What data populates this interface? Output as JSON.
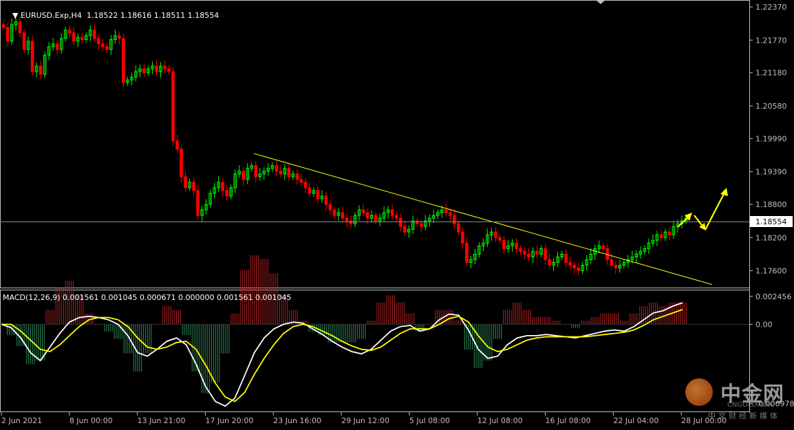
{
  "header": {
    "symbol": "EURUSD.Exp,H4",
    "ohlc": "1.18522 1.18616 1.18511 1.18554"
  },
  "macd_header": {
    "label": "MACD(12,26,9) 0.001561 0.001045 0.000671 0.000000 0.001561 0.001045"
  },
  "current_price": "1.18554",
  "colors": {
    "background": "#000000",
    "bull": "#00ff00",
    "bear": "#ff0000",
    "trendline": "#ffff00",
    "macd_line": "#ffffff",
    "signal_line": "#ffff00",
    "hist_pos": "#b22222",
    "hist_neg": "#2e8b57",
    "axis": "#c0c0c0"
  },
  "watermark": {
    "brand_cn": "中金网",
    "brand_en": "CNGOLD.ORG",
    "tagline": "中文财经新媒体"
  },
  "chart_data": [
    {
      "type": "candlestick",
      "title": "",
      "price_axis_labels": [
        "1.22370",
        "1.21770",
        "1.21180",
        "1.20580",
        "1.19990",
        "1.19390",
        "1.18800",
        "1.18200",
        "1.17600"
      ],
      "time_axis_labels": [
        "2 Jun 2021",
        "8 Jun 00:00",
        "13 Jun 21:00",
        "17 Jun 20:00",
        "23 Jun 16:00",
        "29 Jun 12:00",
        "5 Jul 08:00",
        "12 Jul 08:00",
        "16 Jul 08:00",
        "22 Jul 04:00",
        "28 Jul 00:00"
      ],
      "ylim": [
        1.1732,
        1.2247
      ],
      "close_series": [
        1.22,
        1.2175,
        1.2205,
        1.221,
        1.219,
        1.216,
        1.2175,
        1.212,
        1.213,
        1.2115,
        1.215,
        1.2165,
        1.217,
        1.216,
        1.218,
        1.2195,
        1.219,
        1.2175,
        1.2182,
        1.2178,
        1.2185,
        1.2195,
        1.218,
        1.217,
        1.2165,
        1.216,
        1.2178,
        1.2185,
        1.218,
        1.21,
        1.2105,
        1.211,
        1.212,
        1.2125,
        1.2118,
        1.2125,
        1.213,
        1.212,
        1.213,
        1.2125,
        1.212,
        1.1995,
        1.198,
        1.193,
        1.191,
        1.192,
        1.1905,
        1.186,
        1.187,
        1.188,
        1.19,
        1.191,
        1.192,
        1.1905,
        1.1895,
        1.191,
        1.1935,
        1.194,
        1.1925,
        1.1945,
        1.195,
        1.193,
        1.1935,
        1.194,
        1.1945,
        1.195,
        1.194,
        1.1935,
        1.1945,
        1.193,
        1.1935,
        1.1925,
        1.192,
        1.191,
        1.19,
        1.1905,
        1.189,
        1.1895,
        1.188,
        1.187,
        1.186,
        1.1865,
        1.1855,
        1.185,
        1.1845,
        1.186,
        1.187,
        1.1865,
        1.1855,
        1.186,
        1.185,
        1.1855,
        1.1865,
        1.187,
        1.186,
        1.1855,
        1.184,
        1.183,
        1.1835,
        1.185,
        1.1845,
        1.184,
        1.185,
        1.1855,
        1.186,
        1.1865,
        1.187,
        1.1865,
        1.186,
        1.1845,
        1.183,
        1.181,
        1.1775,
        1.178,
        1.179,
        1.1805,
        1.181,
        1.1825,
        1.183,
        1.182,
        1.1815,
        1.18,
        1.1805,
        1.181,
        1.18,
        1.1795,
        1.179,
        1.1785,
        1.1795,
        1.179,
        1.18,
        1.178,
        1.177,
        1.1775,
        1.1785,
        1.179,
        1.1775,
        1.177,
        1.1765,
        1.176,
        1.177,
        1.178,
        1.179,
        1.18,
        1.1805,
        1.18,
        1.178,
        1.177,
        1.1765,
        1.177,
        1.1775,
        1.178,
        1.1785,
        1.179,
        1.1795,
        1.18,
        1.181,
        1.1815,
        1.1825,
        1.182,
        1.183,
        1.1825,
        1.184,
        1.1845,
        1.185,
        1.1855
      ]
    },
    {
      "type": "macd",
      "title": "",
      "params": "12,26,9",
      "axis_labels": [
        "0.002456",
        "0.00",
        "-0.006978"
      ],
      "ylim": [
        -0.00755,
        0.00287
      ],
      "macd": [
        0.0,
        -0.0003,
        -0.0012,
        -0.0025,
        -0.0032,
        -0.002,
        -0.0008,
        0.0002,
        0.0006,
        0.0007,
        0.0006,
        0.0004,
        0.0,
        -0.001,
        -0.0025,
        -0.0028,
        -0.0022,
        -0.0015,
        -0.0012,
        -0.0018,
        -0.0035,
        -0.0055,
        -0.0068,
        -0.0072,
        -0.0065,
        -0.0045,
        -0.0025,
        -0.0012,
        -0.0004,
        0.0,
        0.0002,
        0.0001,
        -0.0004,
        -0.0009,
        -0.0015,
        -0.002,
        -0.0024,
        -0.0026,
        -0.0022,
        -0.0014,
        -0.0006,
        -0.0002,
        -0.0001,
        -0.0006,
        -0.0004,
        0.0004,
        0.0009,
        0.0008,
        -0.0005,
        -0.0022,
        -0.003,
        -0.0028,
        -0.0018,
        -0.0012,
        -0.001,
        -0.001,
        -0.0009,
        -0.001,
        -0.0011,
        -0.0012,
        -0.001,
        -0.0008,
        -0.0006,
        -0.0005,
        -0.0006,
        -0.0002,
        0.0004,
        0.001,
        0.0012,
        0.0016,
        0.0019
      ],
      "signal": [
        0.0,
        0.0,
        -0.0006,
        -0.0014,
        -0.0022,
        -0.0024,
        -0.0018,
        -0.001,
        -0.0002,
        0.0004,
        0.0006,
        0.0006,
        0.0004,
        -0.0002,
        -0.0012,
        -0.002,
        -0.0022,
        -0.002,
        -0.0016,
        -0.0015,
        -0.0022,
        -0.0036,
        -0.0052,
        -0.0064,
        -0.0068,
        -0.006,
        -0.0044,
        -0.003,
        -0.0018,
        -0.0008,
        -0.0002,
        0.0,
        -0.0002,
        -0.0006,
        -0.001,
        -0.0015,
        -0.0019,
        -0.0022,
        -0.0023,
        -0.002,
        -0.0014,
        -0.0008,
        -0.0004,
        -0.0004,
        -0.0004,
        0.0,
        0.0005,
        0.0007,
        0.0002,
        -0.001,
        -0.002,
        -0.0024,
        -0.0022,
        -0.0018,
        -0.0014,
        -0.0012,
        -0.0011,
        -0.0011,
        -0.0011,
        -0.0011,
        -0.0011,
        -0.001,
        -0.0009,
        -0.0008,
        -0.0007,
        -0.0005,
        -0.0001,
        0.0004,
        0.0007,
        0.001,
        0.0013
      ]
    }
  ]
}
